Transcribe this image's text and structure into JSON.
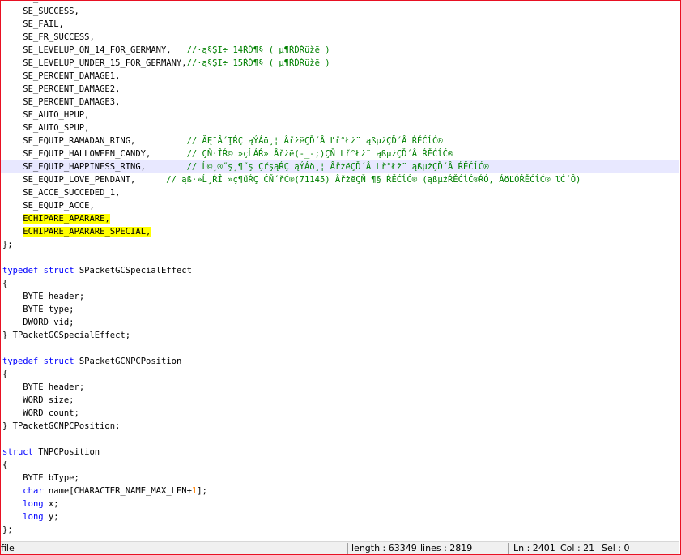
{
  "editor": {
    "lines": [
      [
        {
          "t": "    SE_"
        }
      ],
      [
        {
          "t": "    SE_SUCCESS,"
        }
      ],
      [
        {
          "t": "    SE_FAIL,"
        }
      ],
      [
        {
          "t": "    SE_FR_SUCCESS,"
        }
      ],
      [
        {
          "t": "    SE_LEVELUP_ON_14_FOR_GERMANY,   "
        },
        {
          "t": "//·ą§ŞI÷ 14ŘĎ¶§ ( µ¶ŘĎŘüžë )",
          "c": "cm"
        }
      ],
      [
        {
          "t": "    SE_LEVELUP_UNDER_15_FOR_GERMANY,"
        },
        {
          "t": "//·ą§ŞI÷ 15ŘĎ¶§ ( µ¶ŘĎŘüžë )",
          "c": "cm"
        }
      ],
      [
        {
          "t": "    SE_PERCENT_DAMAGE1,"
        }
      ],
      [
        {
          "t": "    SE_PERCENT_DAMAGE2,"
        }
      ],
      [
        {
          "t": "    SE_PERCENT_DAMAGE3,"
        }
      ],
      [
        {
          "t": "    SE_AUTO_HPUP,"
        }
      ],
      [
        {
          "t": "    SE_AUTO_SPUP,"
        }
      ],
      [
        {
          "t": "    SE_EQUIP_RAMADAN_RING,          "
        },
        {
          "t": "// ĂĘ¯Â´ŢŔÇ ąÝÁö¸¦ ÂřżëÇĎ´Â Ľř°Łż¨ ąßµżÇĎ´Â ŔĚĆĺĆ®",
          "c": "cm"
        }
      ],
      [
        {
          "t": "    SE_EQUIP_HALLOWEEN_CANDY,       "
        },
        {
          "t": "// ÇŇ·ÎŔ© »çĹÁŔ» Âřżë(-_-;)ÇŇ Lř°Łż¨ ąßµżÇĎ´Â ŔĚĆĺĆ®",
          "c": "cm"
        }
      ],
      [
        {
          "t": "    SE_EQUIP_HAPPINESS_RING,        "
        },
        {
          "t": "// Ĺ©¸®˝ş¸¶˝ş ÇŕşąŔÇ ąÝÁö¸¦ ÂřżëÇĎ´Â Lř°Łż¨ ąßµżÇĎ´Â ŔĚĆĺĆ®",
          "c": "cm"
        }
      ],
      [
        {
          "t": "    SE_EQUIP_LOVE_PENDANT,      "
        },
        {
          "t": "// ąß·»Ĺ¸ŔÎ »ç¶űŔÇ ĆŇ´řĆ®(71145) ÂřżëÇŇ ¶§ ŔĚĆĺĆ® (ąßµżŔĚĆĺĆ®ŔÓ, ÁöĽÓŔĚĆĺĆ® ľĆ´Ô)",
          "c": "cm"
        }
      ],
      [
        {
          "t": "    SE_ACCE_SUCCEDED_1,"
        }
      ],
      [
        {
          "t": "    SE_EQUIP_ACCE,"
        }
      ],
      [
        {
          "t": "    "
        },
        {
          "t": "ECHIPARE_APARARE,",
          "c": "hl"
        }
      ],
      [
        {
          "t": "    "
        },
        {
          "t": "ECHIPARE_APARARE_SPECIAL,",
          "c": "hl"
        }
      ],
      [
        {
          "t": "};"
        }
      ],
      [
        {
          "t": ""
        }
      ],
      [
        {
          "t": "typedef",
          "c": "kw"
        },
        {
          "t": " "
        },
        {
          "t": "struct",
          "c": "kw"
        },
        {
          "t": " SPacketGCSpecialEffect"
        }
      ],
      [
        {
          "t": "{"
        }
      ],
      [
        {
          "t": "    BYTE header;"
        }
      ],
      [
        {
          "t": "    BYTE type;"
        }
      ],
      [
        {
          "t": "    DWORD vid;"
        }
      ],
      [
        {
          "t": "} TPacketGCSpecialEffect;"
        }
      ],
      [
        {
          "t": ""
        }
      ],
      [
        {
          "t": "typedef",
          "c": "kw"
        },
        {
          "t": " "
        },
        {
          "t": "struct",
          "c": "kw"
        },
        {
          "t": " SPacketGCNPCPosition"
        }
      ],
      [
        {
          "t": "{"
        }
      ],
      [
        {
          "t": "    BYTE header;"
        }
      ],
      [
        {
          "t": "    WORD size;"
        }
      ],
      [
        {
          "t": "    WORD count;"
        }
      ],
      [
        {
          "t": "} TPacketGCNPCPosition;"
        }
      ],
      [
        {
          "t": ""
        }
      ],
      [
        {
          "t": "struct",
          "c": "kw"
        },
        {
          "t": " TNPCPosition"
        }
      ],
      [
        {
          "t": "{"
        }
      ],
      [
        {
          "t": "    BYTE bType;"
        }
      ],
      [
        {
          "t": "    "
        },
        {
          "t": "char",
          "c": "kw"
        },
        {
          "t": " name[CHARACTER_NAME_MAX_LEN+"
        },
        {
          "t": "1",
          "c": "num"
        },
        {
          "t": "];"
        }
      ],
      [
        {
          "t": "    "
        },
        {
          "t": "long",
          "c": "kw"
        },
        {
          "t": " x;"
        }
      ],
      [
        {
          "t": "    "
        },
        {
          "t": "long",
          "c": "kw"
        },
        {
          "t": " y;"
        }
      ],
      [
        {
          "t": "};"
        }
      ],
      [
        {
          "t": ""
        }
      ]
    ],
    "current_line_index": 13
  },
  "statusbar": {
    "file_type": "file",
    "length": "length : 63349",
    "lines": "lines : 2819",
    "ln": "Ln : 2401",
    "col": "Col : 21",
    "sel": "Sel : 0"
  },
  "colors": {
    "keyword": "#0000ff",
    "comment": "#008000",
    "number": "#ff8000",
    "highlight": "#ffff00",
    "current_line": "#e8e8ff",
    "frame": "#e81123"
  }
}
